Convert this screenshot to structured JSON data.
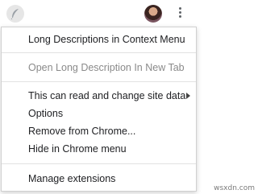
{
  "toolbar": {
    "extension_icon": "extension-feather-icon",
    "avatar_icon": "profile-avatar-icon",
    "menu_icon": "vertical-ellipsis-icon"
  },
  "menu": {
    "items": [
      {
        "label": "Long Descriptions in Context Menu",
        "enabled": true
      },
      {
        "label": "Open Long Description In New Tab",
        "enabled": false
      },
      {
        "label": "This can read and change site data",
        "enabled": true,
        "has_submenu": true
      },
      {
        "label": "Options",
        "enabled": true
      },
      {
        "label": "Remove from Chrome...",
        "enabled": true
      },
      {
        "label": "Hide in Chrome menu",
        "enabled": true
      },
      {
        "label": "Manage extensions",
        "enabled": true
      }
    ]
  },
  "watermark": "wsxdn.com",
  "colors": {
    "text": "#202124",
    "disabled_text": "#8a8a8a",
    "separator": "#e2e2e2"
  }
}
